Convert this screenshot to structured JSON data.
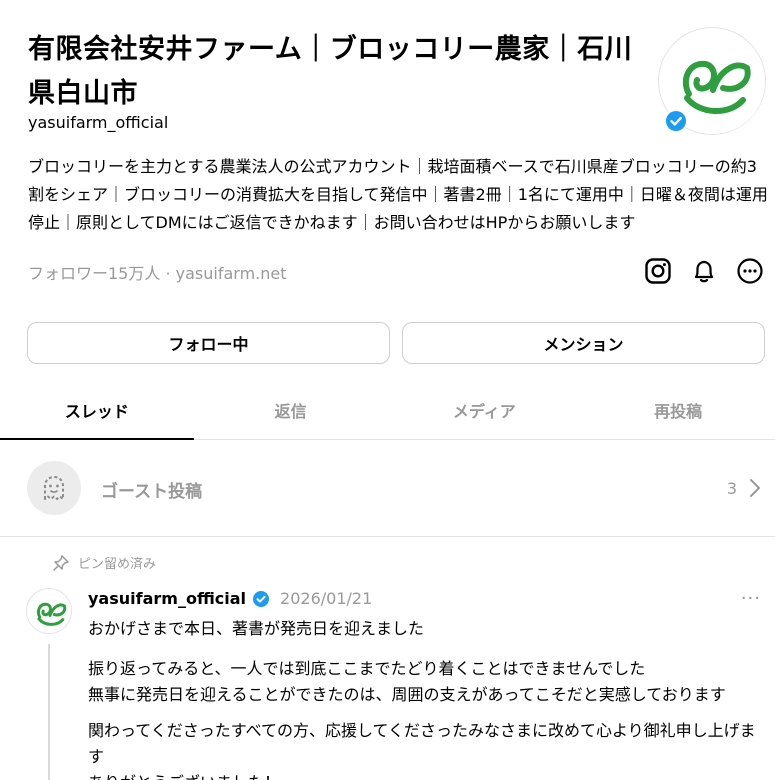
{
  "profile": {
    "name": "有限会社安井ファーム｜ブロッコリー農家｜石川県白山市",
    "handle": "yasuifarm_official",
    "bio": "ブロッコリーを主力とする農業法人の公式アカウント｜栽培面積ベースで石川県産ブロッコリーの約3割をシェア｜ブロッコリーの消費拡大を目指して発信中｜著書2冊｜1名にて運用中｜日曜＆夜間は運用停止｜原則としてDMにはご返信できかねます｜お問い合わせはHPからお願いします",
    "followers": "フォロワー15万人",
    "separator": "·",
    "website": "yasuifarm.net",
    "brand_color": "#2e9e3e",
    "verified_color": "#1d9bf0"
  },
  "actions": {
    "icons": [
      "instagram-icon",
      "bell-icon",
      "more-icon"
    ],
    "follow_label": "フォロー中",
    "mention_label": "メンション"
  },
  "tabs": [
    {
      "label": "スレッド",
      "active": true
    },
    {
      "label": "返信",
      "active": false
    },
    {
      "label": "メディア",
      "active": false
    },
    {
      "label": "再投稿",
      "active": false
    }
  ],
  "ghost": {
    "label": "ゴースト投稿",
    "count": "3"
  },
  "post": {
    "pinned_label": "ピン留め済み",
    "author": "yasuifarm_official",
    "date": "2026/01/21",
    "more": "···",
    "paragraphs": [
      "おかげさまで本日、著書が発売日を迎えました",
      "振り返ってみると、一人では到底ここまでたどり着くことはできませんでした\n無事に発売日を迎えることができたのは、周囲の支えがあってこそだと実感しております",
      "関わってくださったすべての方、応援してくださったみなさまに改めて心より御礼申し上げます\nありがとうございました！"
    ]
  }
}
